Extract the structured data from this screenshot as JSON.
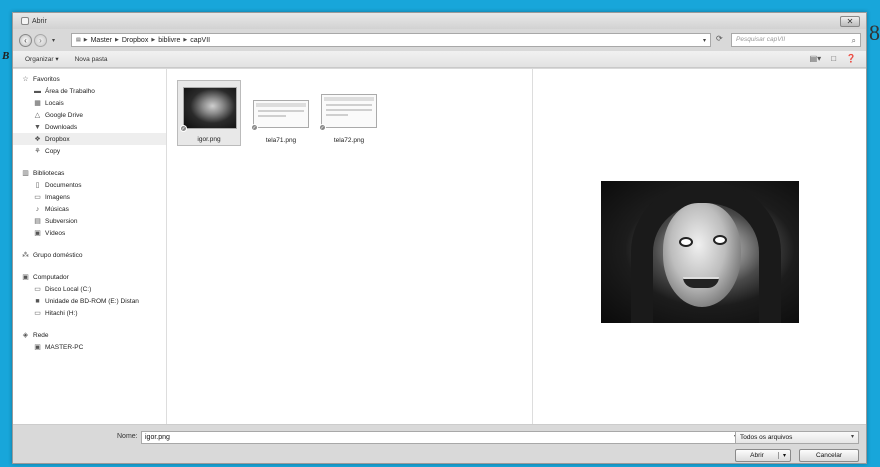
{
  "window": {
    "title": "Abrir",
    "close_glyph": "✕"
  },
  "background": {
    "left_letter": "B",
    "right_letter": "8"
  },
  "nav": {
    "breadcrumbs": [
      "Master",
      "Dropbox",
      "biblivre",
      "capVII"
    ],
    "search_placeholder": "Pesquisar capVII"
  },
  "toolbar": {
    "organize": "Organizar ▾",
    "new_folder": "Nova pasta"
  },
  "sidebar": {
    "favorites": {
      "label": "Favoritos",
      "items": [
        "Área de Trabalho",
        "Locais",
        "Google Drive",
        "Downloads",
        "Dropbox",
        "Copy"
      ]
    },
    "libraries": {
      "label": "Bibliotecas",
      "items": [
        "Documentos",
        "Imagens",
        "Músicas",
        "Subversion",
        "Vídeos"
      ]
    },
    "homegroup": "Grupo doméstico",
    "computer": {
      "label": "Computador",
      "items": [
        "Disco Local (C:)",
        "Unidade de BD-ROM (E:) Distan",
        "Hitachi (H:)"
      ]
    },
    "network": {
      "label": "Rede",
      "items": [
        "MASTER-PC"
      ]
    }
  },
  "files": [
    {
      "name": "igor.png"
    },
    {
      "name": "tela71.png"
    },
    {
      "name": "tela72.png"
    }
  ],
  "footer": {
    "name_label": "Nome:",
    "name_value": "igor.png",
    "file_type": "Todos os arquivos",
    "open_label": "Abrir",
    "cancel_label": "Cancelar"
  }
}
